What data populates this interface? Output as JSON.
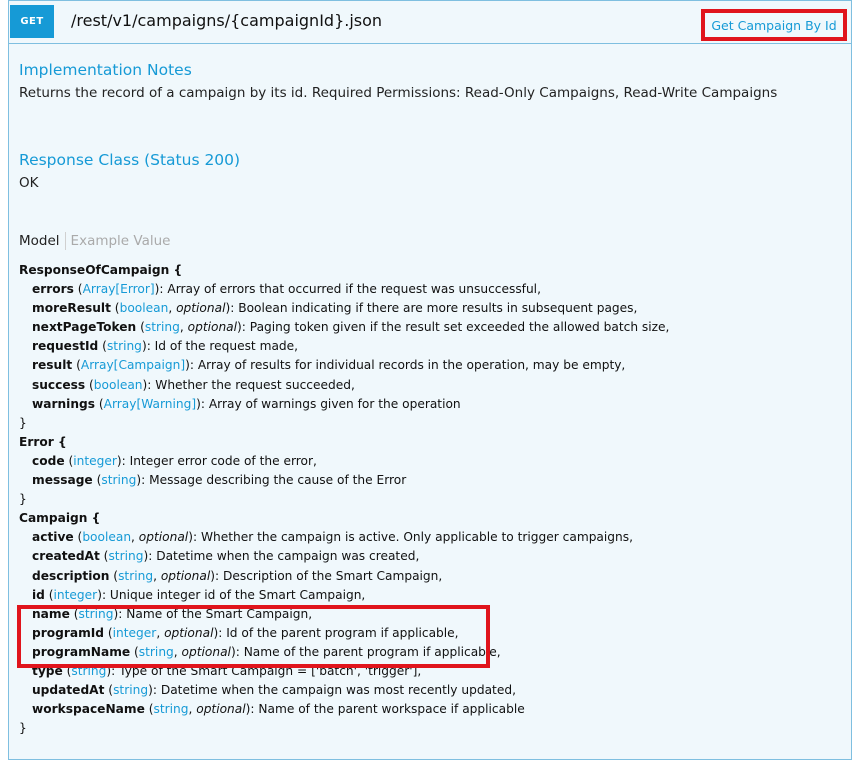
{
  "endpoint": {
    "method": "GET",
    "path": "/rest/v1/campaigns/{campaignId}.json",
    "summary": "Get Campaign By Id"
  },
  "implementation": {
    "heading": "Implementation Notes",
    "text": "Returns the record of a campaign by its id. Required Permissions: Read-Only Campaigns, Read-Write Campaigns"
  },
  "response_class": {
    "heading": "Response Class (Status 200)",
    "text": "OK"
  },
  "model_tabs": {
    "model": "Model",
    "example": "Example Value"
  },
  "schema": {
    "response_of_campaign": {
      "header": "ResponseOfCampaign {",
      "props": [
        {
          "name": "errors",
          "type": "Array[Error]",
          "optional": "",
          "desc": "): Array of errors that occurred if the request was unsuccessful,"
        },
        {
          "name": "moreResult",
          "type": "boolean",
          "optional": "optional",
          "desc": "): Boolean indicating if there are more results in subsequent pages,"
        },
        {
          "name": "nextPageToken",
          "type": "string",
          "optional": "optional",
          "desc": "): Paging token given if the result set exceeded the allowed batch size,"
        },
        {
          "name": "requestId",
          "type": "string",
          "optional": "",
          "desc": "): Id of the request made,"
        },
        {
          "name": "result",
          "type": "Array[Campaign]",
          "optional": "",
          "desc": "): Array of results for individual records in the operation, may be empty,"
        },
        {
          "name": "success",
          "type": "boolean",
          "optional": "",
          "desc": "): Whether the request succeeded,"
        },
        {
          "name": "warnings",
          "type": "Array[Warning]",
          "optional": "",
          "desc": "): Array of warnings given for the operation"
        }
      ],
      "close": "}"
    },
    "error": {
      "header": "Error {",
      "props": [
        {
          "name": "code",
          "type": "integer",
          "optional": "",
          "desc": "): Integer error code of the error,"
        },
        {
          "name": "message",
          "type": "string",
          "optional": "",
          "desc": "): Message describing the cause of the Error"
        }
      ],
      "close": "}"
    },
    "campaign": {
      "header": "Campaign {",
      "props": [
        {
          "name": "active",
          "type": "boolean",
          "optional": "optional",
          "desc": "): Whether the campaign is active. Only applicable to trigger campaigns,"
        },
        {
          "name": "createdAt",
          "type": "string",
          "optional": "",
          "desc": "): Datetime when the campaign was created,"
        },
        {
          "name": "description",
          "type": "string",
          "optional": "optional",
          "desc": "): Description of the Smart Campaign,"
        },
        {
          "name": "id",
          "type": "integer",
          "optional": "",
          "desc": "): Unique integer id of the Smart Campaign,"
        },
        {
          "name": "name",
          "type": "string",
          "optional": "",
          "desc": "): Name of the Smart Campaign,"
        },
        {
          "name": "programId",
          "type": "integer",
          "optional": "optional",
          "desc": "): Id of the parent program if applicable,"
        },
        {
          "name": "programName",
          "type": "string",
          "optional": "optional",
          "desc": "): Name of the parent program if applicable,"
        },
        {
          "name": "type",
          "type": "string",
          "optional": "",
          "desc": "): Type of the Smart Campaign = ['batch', 'trigger'],"
        },
        {
          "name": "updatedAt",
          "type": "string",
          "optional": "",
          "desc": "): Datetime when the campaign was most recently updated,"
        },
        {
          "name": "workspaceName",
          "type": "string",
          "optional": "optional",
          "desc": "): Name of the parent workspace if applicable"
        }
      ],
      "close": "}"
    }
  },
  "colors": {
    "accent": "#169ad6",
    "highlight": "#e0141c",
    "panel_bg": "#f0f8fc",
    "panel_border": "#7fbfe0"
  }
}
